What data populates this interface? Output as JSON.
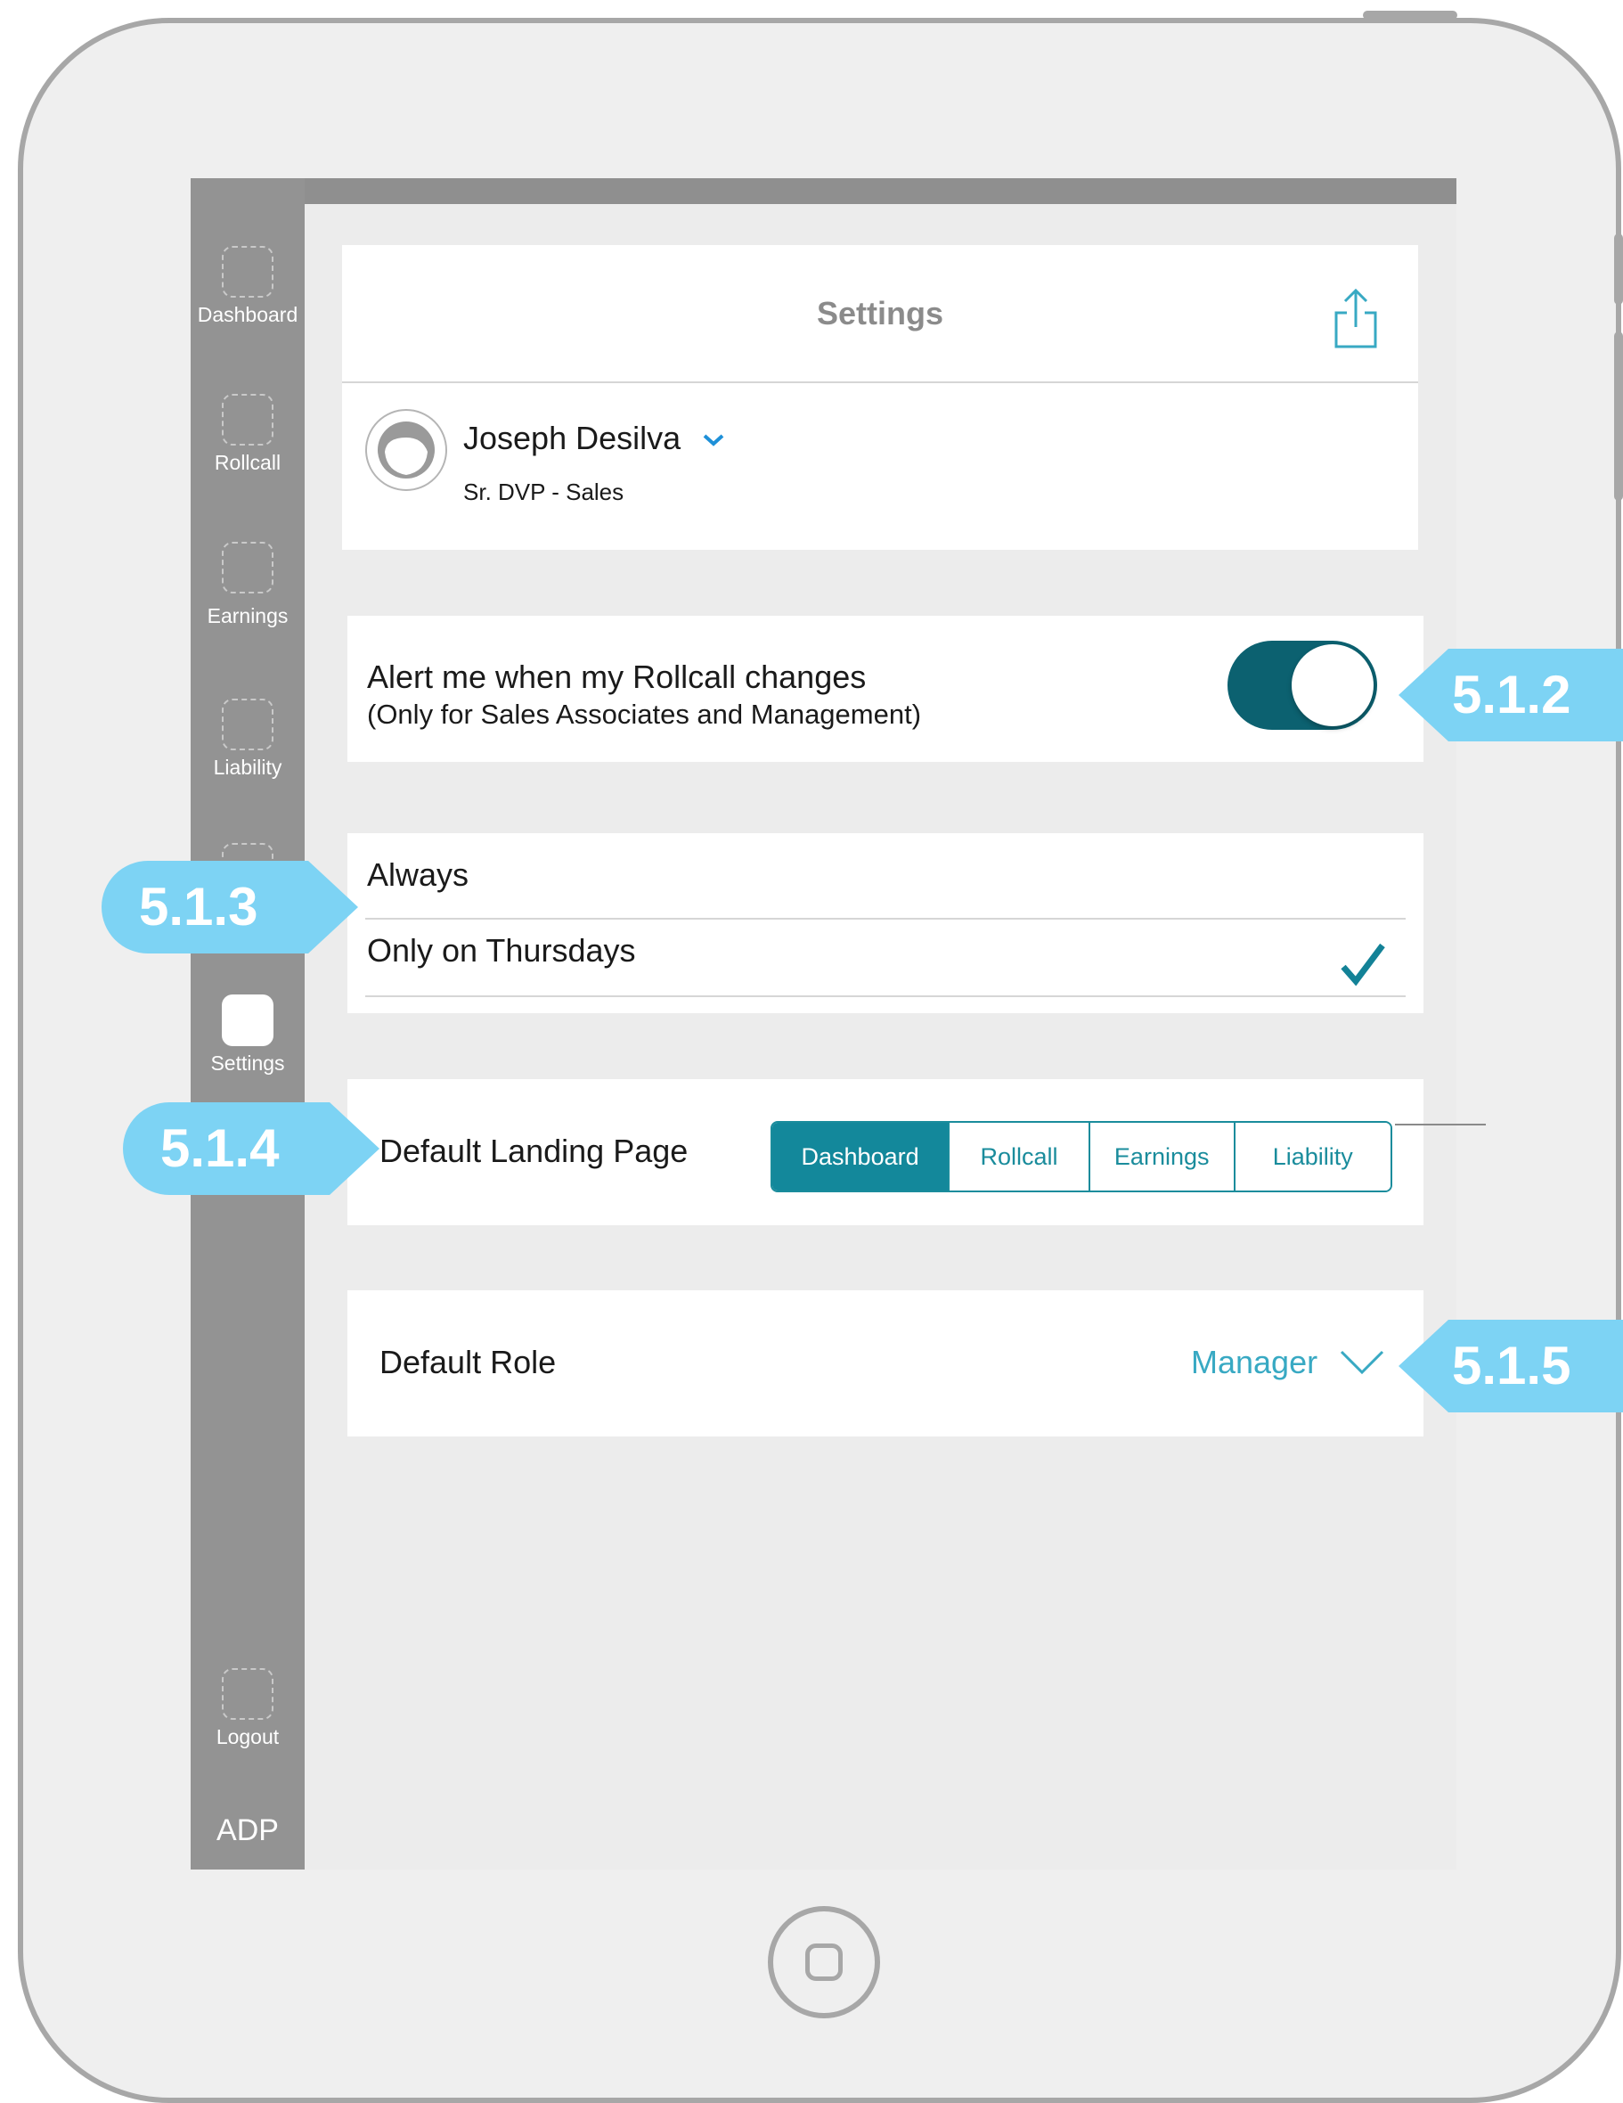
{
  "sidebar": {
    "items": [
      {
        "label": "Dashboard"
      },
      {
        "label": "Rollcall"
      },
      {
        "label": "Earnings"
      },
      {
        "label": "Liability"
      },
      {
        "label": "Settings"
      },
      {
        "label": "Logout"
      }
    ],
    "brand": "ADP"
  },
  "header": {
    "title": "Settings",
    "share_icon": "share-icon"
  },
  "profile": {
    "name": "Joseph Desilva",
    "title": "Sr. DVP  - Sales"
  },
  "alert": {
    "label": "Alert me when my Rollcall changes",
    "note": "(Only for Sales Associates and Management)",
    "enabled": true
  },
  "frequency": {
    "options": [
      "Always",
      "Only on Thursdays"
    ],
    "selected": "Only on Thursdays"
  },
  "landing": {
    "label": "Default Landing Page",
    "options": [
      "Dashboard",
      "Rollcall",
      "Earnings",
      "Liability"
    ],
    "selected": "Dashboard"
  },
  "role": {
    "label": "Default Role",
    "value": "Manager"
  },
  "callouts": {
    "c512": "5.1.2",
    "c513": "5.1.3",
    "c514": "5.1.4",
    "c515": "5.1.5"
  },
  "colors": {
    "accent": "#13889b",
    "toggle_on": "#0c6170",
    "callout": "#7dd3f4",
    "role_value": "#38a9c3"
  }
}
